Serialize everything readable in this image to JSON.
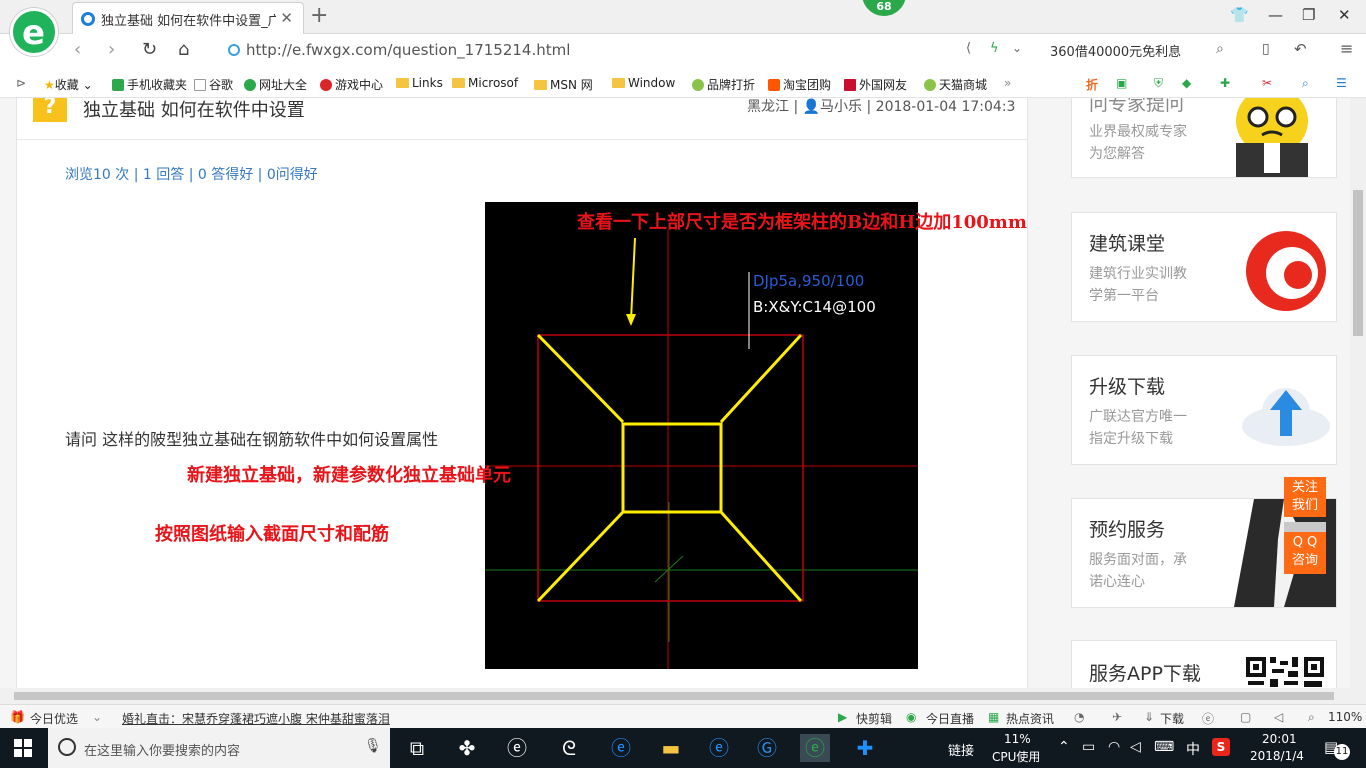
{
  "browser": {
    "tab_title": "独立基础 如何在软件中设置_广联",
    "tab_close": "✕",
    "new_tab": "+",
    "badge_count": "68",
    "url": "http://e.fwxgx.com/question_1715214.html",
    "search_text": "360借40000元免利息"
  },
  "bookmarks": [
    {
      "label": "收藏"
    },
    {
      "label": "手机收藏夹"
    },
    {
      "label": "谷歌"
    },
    {
      "label": "网址大全"
    },
    {
      "label": "游戏中心"
    },
    {
      "label": "Links"
    },
    {
      "label": "Microsof"
    },
    {
      "label": "MSN 网"
    },
    {
      "label": "Window"
    },
    {
      "label": "品牌打折"
    },
    {
      "label": "淘宝团购"
    },
    {
      "label": "外国网友"
    },
    {
      "label": "天猫商城"
    }
  ],
  "question": {
    "icon": "?",
    "title": "独立基础 如何在软件中设置",
    "meta": "黑龙江 | 👤马小乐 | 2018-01-04 17:04:3",
    "stats": "浏览10 次 | 1 回答 | 0 答得好 | 0问得好",
    "body": "请问 这样的陂型独立基础在钢筋软件中如何设置属性"
  },
  "annotations": {
    "top_note": "查看一下上部尺寸是否为框架柱的B边和H边加100mm",
    "step1": "新建独立基础，新建参数化独立基础单元",
    "step2": "按照图纸输入截面尺寸和配筋"
  },
  "cad": {
    "label_line1": "DJp5a,950/100",
    "label_line2": "B:X&Y:C14@100"
  },
  "sidebar": {
    "cards": [
      {
        "title": "问专家提问",
        "sub1": "业界最权威专家",
        "sub2": "为您解答"
      },
      {
        "title": "建筑课堂",
        "sub1": "建筑行业实训教",
        "sub2": "学第一平台"
      },
      {
        "title": "升级下载",
        "sub1": "广联达官方唯一",
        "sub2": "指定升级下载"
      },
      {
        "title": "预约服务",
        "sub1": "服务面对面，承",
        "sub2": "诺心连心"
      },
      {
        "title": "服务APP下载"
      }
    ],
    "follow_line1": "关注",
    "follow_line2": "我们",
    "qq_line1": "Q Q",
    "qq_line2": "咨询"
  },
  "statusbar": {
    "today": "今日优选",
    "news": "婚礼直击：宋慧乔穿蓬裙巧遮小腹 宋仲基甜蜜落泪",
    "quickclip": "快剪辑",
    "live": "今日直播",
    "hotnews": "热点资讯",
    "download": "下载",
    "zoom": "110%"
  },
  "taskbar": {
    "search_placeholder": "在这里输入你要搜索的内容",
    "link": "链接",
    "cpu_value": "11%",
    "cpu_label": "CPU使用",
    "ime": "中",
    "time": "20:01",
    "date": "2018/1/4",
    "notif_count": "11"
  },
  "colors": {
    "annotation_red": "#e8141a",
    "cad_yellow": "#ffee00",
    "cad_red": "#c0000a",
    "link_blue": "#3478c6",
    "accent_orange": "#ff6a14"
  }
}
